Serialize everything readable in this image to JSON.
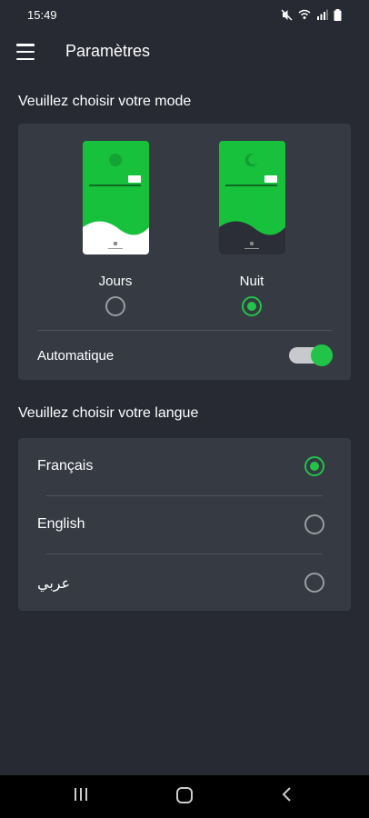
{
  "status_bar": {
    "time": "15:49",
    "icons": [
      "mute-icon",
      "wifi-call-icon",
      "signal-icon",
      "battery-icon"
    ]
  },
  "app_bar": {
    "title": "Paramètres",
    "menu_icon": "hamburger-menu-icon"
  },
  "mode_section": {
    "title": "Veuillez choisir votre mode",
    "options": [
      {
        "label": "Jours",
        "selected": false
      },
      {
        "label": "Nuit",
        "selected": true
      }
    ],
    "automatic": {
      "label": "Automatique",
      "enabled": true
    }
  },
  "language_section": {
    "title": "Veuillez choisir votre langue",
    "options": [
      {
        "label": "Français",
        "selected": true
      },
      {
        "label": "English",
        "selected": false
      },
      {
        "label": "عربي",
        "selected": false
      }
    ]
  },
  "nav_bar": {
    "icons": [
      "recents-icon",
      "home-icon",
      "back-icon"
    ]
  },
  "colors": {
    "background": "#272a32",
    "card": "#363a43",
    "accent": "#21c348",
    "phone_green": "#17c13c"
  }
}
